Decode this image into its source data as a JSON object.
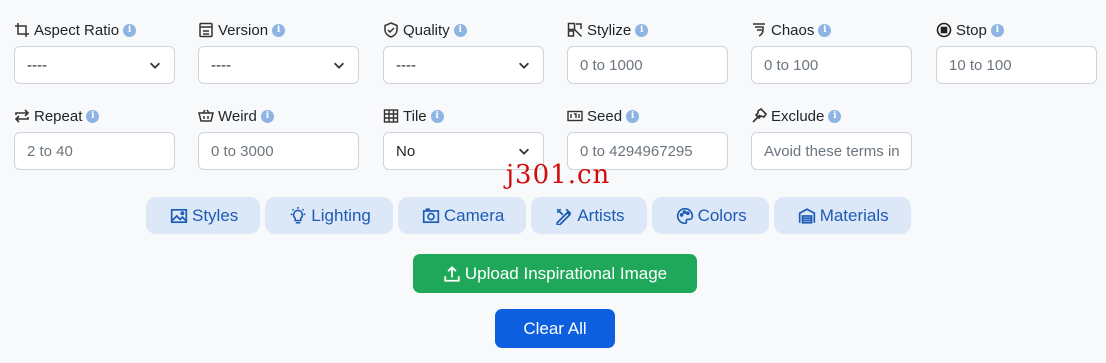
{
  "row1": [
    {
      "label": "Aspect Ratio",
      "icon": "crop-icon",
      "type": "select",
      "value": "----"
    },
    {
      "label": "Version",
      "icon": "version-icon",
      "type": "select",
      "value": "----"
    },
    {
      "label": "Quality",
      "icon": "shield-check-icon",
      "type": "select",
      "value": "----"
    },
    {
      "label": "Stylize",
      "icon": "stylize-icon",
      "type": "input",
      "placeholder": "0 to 1000"
    },
    {
      "label": "Chaos",
      "icon": "chaos-icon",
      "type": "input",
      "placeholder": "0 to 100"
    },
    {
      "label": "Stop",
      "icon": "stop-circle-icon",
      "type": "input",
      "placeholder": "10 to 100"
    }
  ],
  "row2": [
    {
      "label": "Repeat",
      "icon": "repeat-icon",
      "type": "input",
      "placeholder": "2 to 40"
    },
    {
      "label": "Weird",
      "icon": "weird-icon",
      "type": "input",
      "placeholder": "0 to 3000"
    },
    {
      "label": "Tile",
      "icon": "grid-icon",
      "type": "select",
      "value": "No"
    },
    {
      "label": "Seed",
      "icon": "seed-icon",
      "type": "input",
      "placeholder": "0 to 4294967295"
    },
    {
      "label": "Exclude",
      "icon": "hammer-icon",
      "type": "input",
      "placeholder": "Avoid these terms in"
    }
  ],
  "info_glyph": "i",
  "categories": [
    "Styles",
    "Lighting",
    "Camera",
    "Artists",
    "Colors",
    "Materials"
  ],
  "upload_label": "Upload Inspirational Image",
  "clear_label": "Clear All",
  "watermark": "j301.cn",
  "colors": {
    "pill_bg": "#dce8f7",
    "pill_text": "#1e5bb5",
    "upload_bg": "#1fa85a",
    "clear_bg": "#0d5fe0",
    "info": "#8db4e3"
  }
}
